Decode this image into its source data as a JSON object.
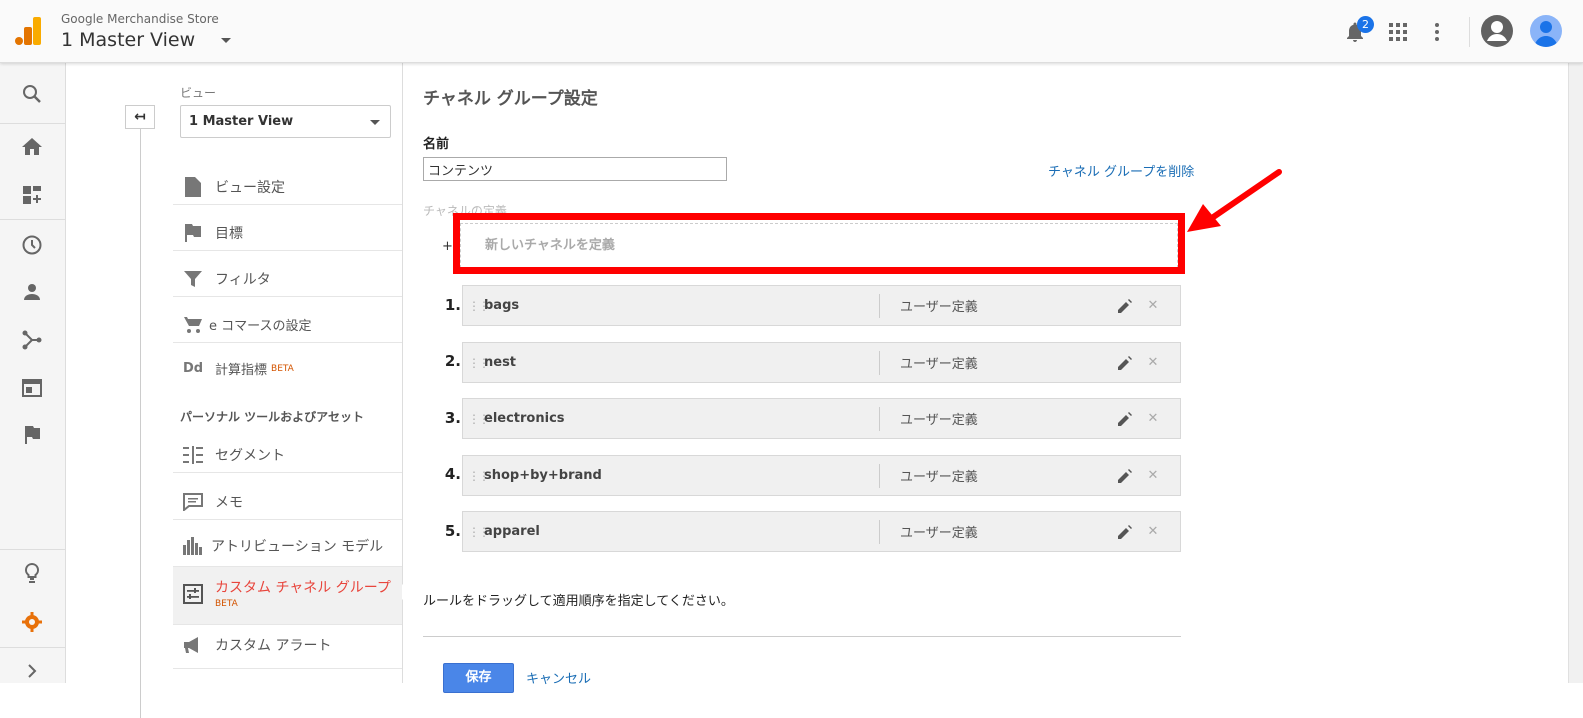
{
  "header": {
    "account": "Google Merchandise Store",
    "view": "1 Master View",
    "notification_count": "2"
  },
  "panel": {
    "view_label": "ビュー",
    "view_value": "1 Master View",
    "items": [
      {
        "label": "ビュー設定"
      },
      {
        "label": "目標"
      },
      {
        "label": "フィルタ"
      },
      {
        "label": "e コマースの設定"
      },
      {
        "label": "計算指標",
        "badge": "BETA"
      }
    ],
    "section_title": "パーソナル ツールおよびアセット",
    "tools": [
      {
        "label": "セグメント"
      },
      {
        "label": "メモ"
      },
      {
        "label": "アトリビューション モデル"
      },
      {
        "label": "カスタム チャネル グループ",
        "badge": "BETA"
      },
      {
        "label": "カスタム アラート"
      }
    ]
  },
  "main": {
    "title": "チャネル グループ設定",
    "name_label": "名前",
    "name_value": "コンテンツ",
    "delete_link": "チャネル グループを削除",
    "definition_label": "チャネルの定義",
    "plus": "+",
    "new_channel": "新しいチャネルを定義",
    "rules": [
      {
        "num": "1.",
        "name": "bags",
        "type": "ユーザー定義"
      },
      {
        "num": "2.",
        "name": "nest",
        "type": "ユーザー定義"
      },
      {
        "num": "3.",
        "name": "electronics",
        "type": "ユーザー定義"
      },
      {
        "num": "4.",
        "name": "shop+by+brand",
        "type": "ユーザー定義"
      },
      {
        "num": "5.",
        "name": "apparel",
        "type": "ユーザー定義"
      }
    ],
    "hint": "ルールをドラッグして適用順序を指定してください。",
    "save": "保存",
    "cancel": "キャンセル"
  },
  "colors": {
    "accent": "#e8453c",
    "link": "#1a6db5",
    "highlight": "#ff0000",
    "primary_button": "#4a86e8"
  }
}
